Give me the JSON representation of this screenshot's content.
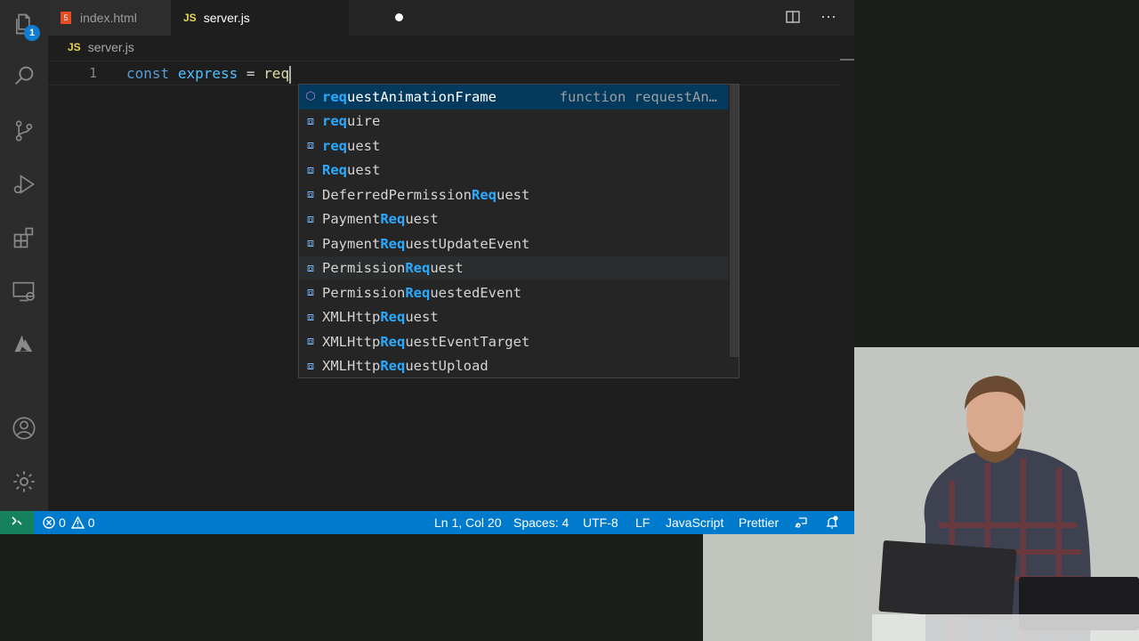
{
  "tabs": [
    {
      "label": "index.html",
      "icon": "html5-icon"
    },
    {
      "label": "server.js",
      "icon": "js-icon",
      "js": "JS"
    }
  ],
  "breadcrumb": {
    "js": "JS",
    "file": "server.js"
  },
  "activity": {
    "explorer_badge": "1"
  },
  "editor": {
    "line_number": "1",
    "tokens": {
      "kw": "const",
      "name": "express",
      "eq": "=",
      "typed": "req"
    }
  },
  "suggestions": [
    {
      "prefix": "",
      "match": "req",
      "rest": "uestAnimationFrame",
      "detail": "function requestAn…",
      "icon": "cube-icon"
    },
    {
      "prefix": "",
      "match": "req",
      "rest": "uire",
      "icon": "variable-icon"
    },
    {
      "prefix": "",
      "match": "req",
      "rest": "uest",
      "icon": "variable-icon"
    },
    {
      "prefix": "",
      "match": "Req",
      "rest": "uest",
      "icon": "variable-icon"
    },
    {
      "prefix": "DeferredPermission",
      "match": "Req",
      "rest": "uest",
      "icon": "variable-icon"
    },
    {
      "prefix": "Payment",
      "match": "Req",
      "rest": "uest",
      "icon": "variable-icon"
    },
    {
      "prefix": "Payment",
      "match": "Req",
      "rest": "uestUpdateEvent",
      "icon": "variable-icon"
    },
    {
      "prefix": "Permission",
      "match": "Req",
      "rest": "uest",
      "icon": "variable-icon"
    },
    {
      "prefix": "Permission",
      "match": "Req",
      "rest": "uestedEvent",
      "icon": "variable-icon"
    },
    {
      "prefix": "XMLHttp",
      "match": "Req",
      "rest": "uest",
      "icon": "variable-icon"
    },
    {
      "prefix": "XMLHttp",
      "match": "Req",
      "rest": "uestEventTarget",
      "icon": "variable-icon"
    },
    {
      "prefix": "XMLHttp",
      "match": "Req",
      "rest": "uestUpload",
      "icon": "variable-icon"
    }
  ],
  "status": {
    "errors": "0",
    "warnings": "0",
    "position": "Ln 1, Col 20",
    "spaces": "Spaces: 4",
    "encoding": "UTF-8",
    "eol": "LF",
    "language": "JavaScript",
    "formatter": "Prettier"
  },
  "colors": {
    "accent": "#007acc",
    "remote": "#16825d",
    "match": "#2aaaff"
  }
}
